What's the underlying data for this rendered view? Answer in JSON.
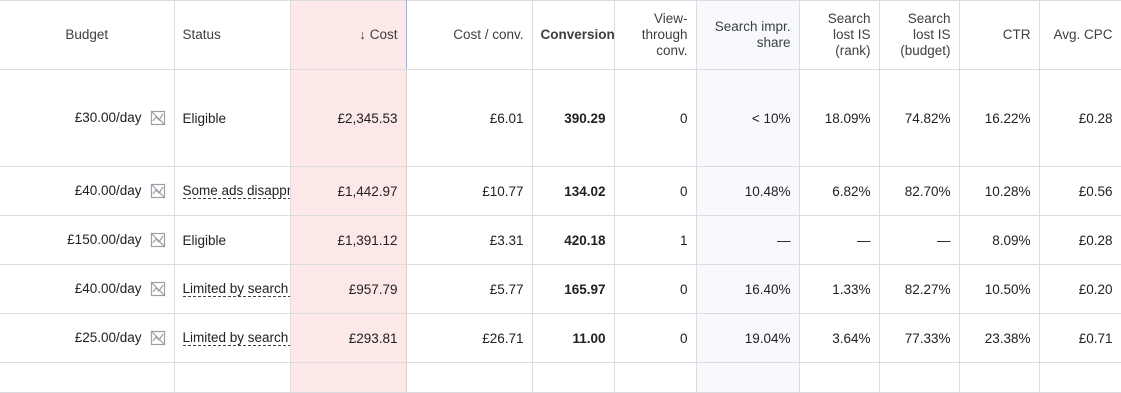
{
  "headers": {
    "budget": "Budget",
    "status": "Status",
    "cost": "Cost",
    "cost_per_conv": "Cost / conv.",
    "conversions": "Conversions",
    "view_through": "View-through conv.",
    "search_impr_share": "Search impr. share",
    "lost_rank": "Search lost IS (rank)",
    "lost_budget": "Search lost IS (budget)",
    "ctr": "CTR",
    "avg_cpc": "Avg. CPC"
  },
  "icons": {
    "budget": "budget-chart-off-icon",
    "sort": "arrow-down-icon"
  },
  "rows": [
    {
      "budget": "£30.00/day",
      "status": "Eligible",
      "cost": "£2,345.53",
      "cpc": "£6.01",
      "conv": "390.29",
      "vtc": "0",
      "sis": "< 10%",
      "rank": "18.09%",
      "lbudget": "74.82%",
      "ctr": "16.22%",
      "acpc": "£0.28"
    },
    {
      "budget": "£40.00/day",
      "status": "Some ads disapproved",
      "cost": "£1,442.97",
      "cpc": "£10.77",
      "conv": "134.02",
      "vtc": "0",
      "sis": "10.48%",
      "rank": "6.82%",
      "lbudget": "82.70%",
      "ctr": "10.28%",
      "acpc": "£0.56"
    },
    {
      "budget": "£150.00/day",
      "status": "Eligible",
      "cost": "£1,391.12",
      "cpc": "£3.31",
      "conv": "420.18",
      "vtc": "1",
      "sis": "—",
      "rank": "—",
      "lbudget": "—",
      "ctr": "8.09%",
      "acpc": "£0.28"
    },
    {
      "budget": "£40.00/day",
      "status": "Limited by search volume",
      "cost": "£957.79",
      "cpc": "£5.77",
      "conv": "165.97",
      "vtc": "0",
      "sis": "16.40%",
      "rank": "1.33%",
      "lbudget": "82.27%",
      "ctr": "10.50%",
      "acpc": "£0.20"
    },
    {
      "budget": "£25.00/day",
      "status": "Limited by search volume",
      "cost": "£293.81",
      "cpc": "£26.71",
      "conv": "11.00",
      "vtc": "0",
      "sis": "19.04%",
      "rank": "3.64%",
      "lbudget": "77.33%",
      "ctr": "23.38%",
      "acpc": "£0.71"
    }
  ]
}
